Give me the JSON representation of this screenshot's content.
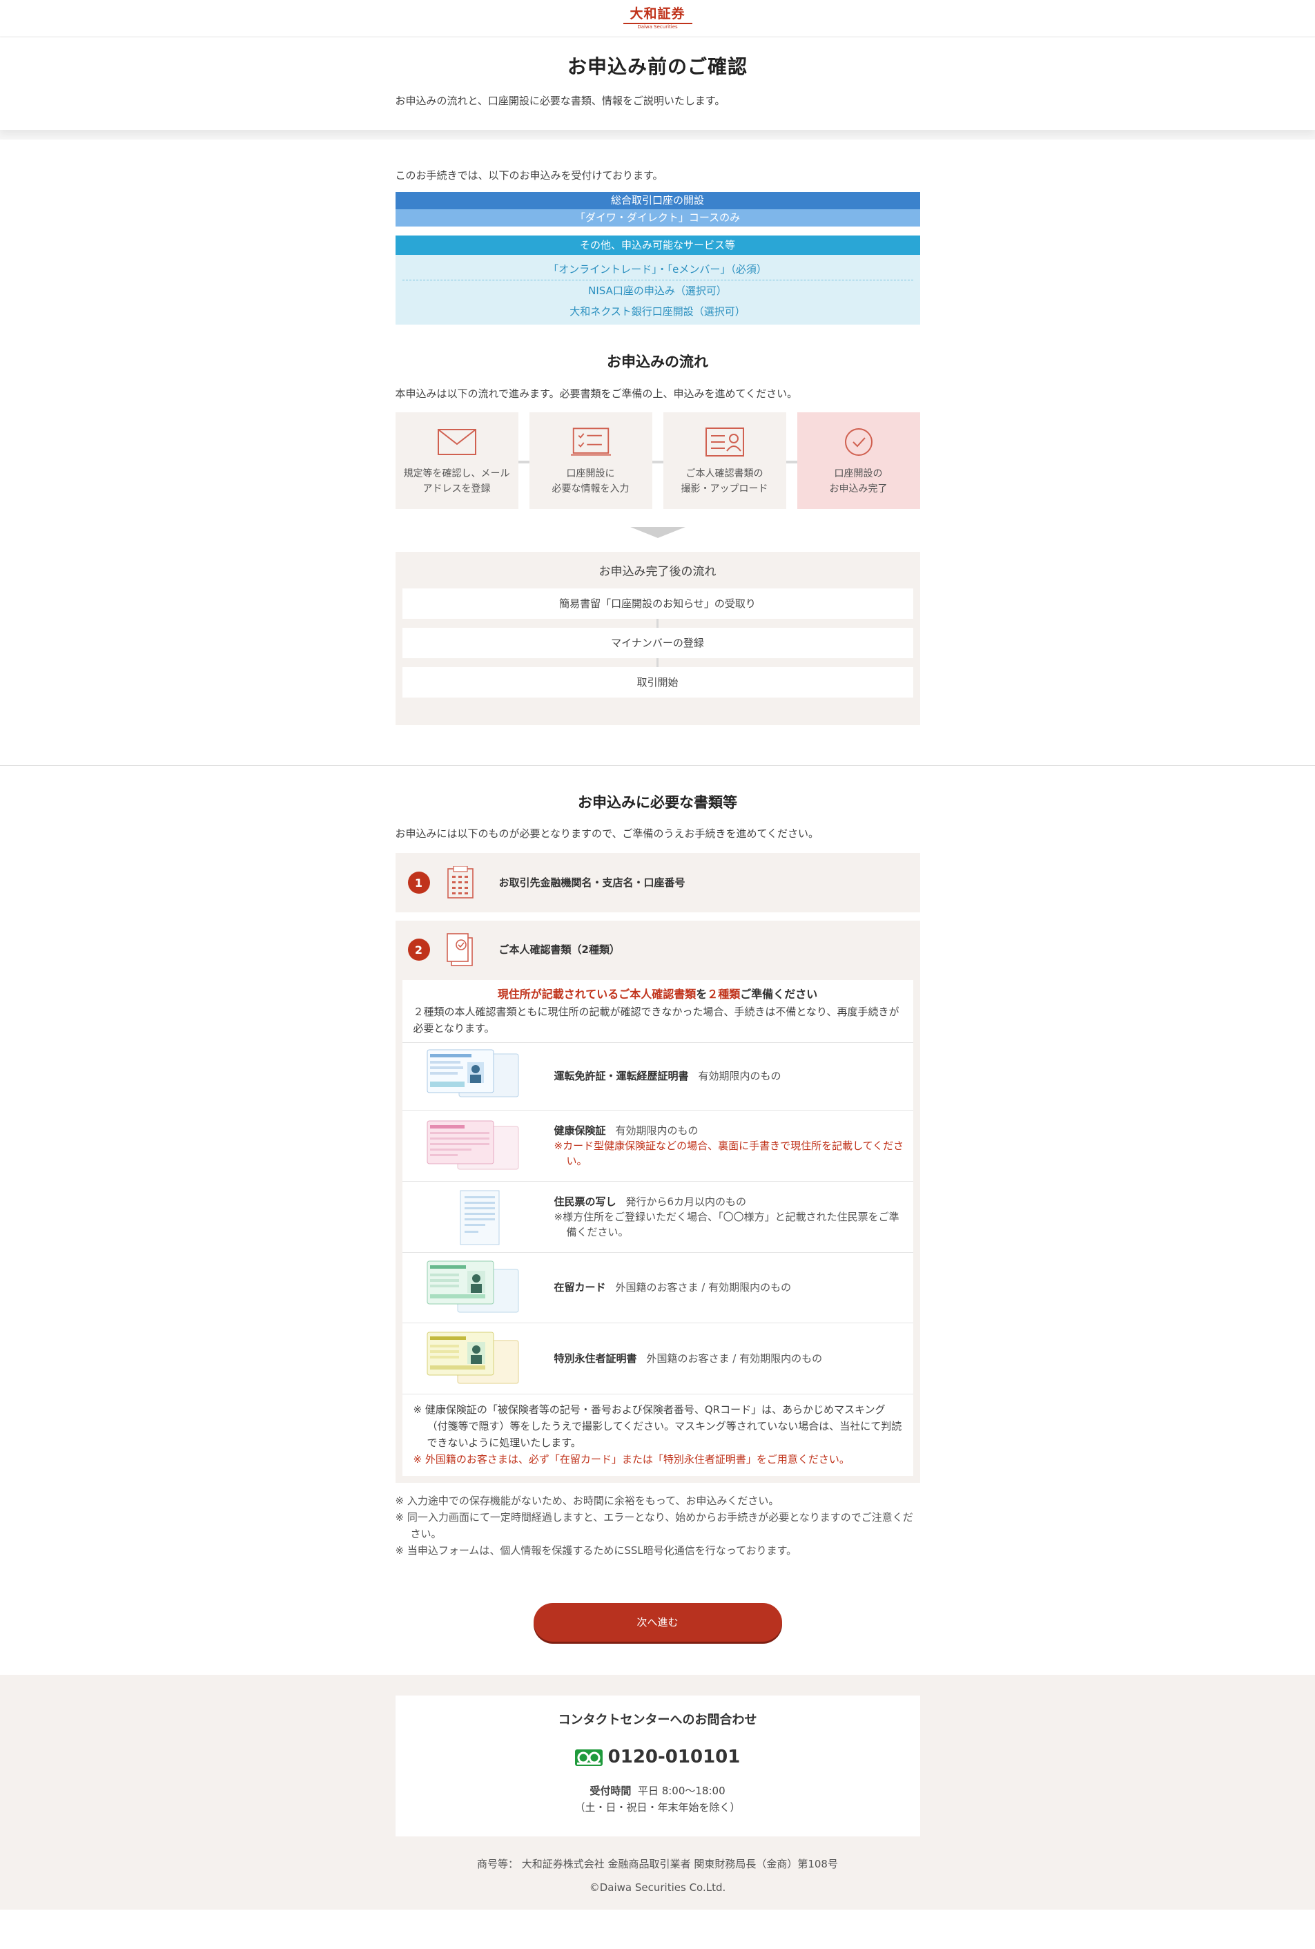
{
  "logo": {
    "jp": "大和証券",
    "en": "Daiwa Securities"
  },
  "header": {
    "title": "お申込み前のご確認",
    "subtitle": "お申込みの流れと、口座開設に必要な書類、情報をご説明いたします。"
  },
  "intro": "このお手続きでは、以下のお申込みを受付けております。",
  "service_main": {
    "title": "総合取引口座の開設",
    "sub": "「ダイワ・ダイレクト」コースのみ"
  },
  "service_other": {
    "title": "その他、申込み可能なサービス等",
    "items": [
      "「オンライントレード」・「eメンバー」（必須）",
      "NISA口座の申込み（選択可）",
      "大和ネクスト銀行口座開設（選択可）"
    ]
  },
  "flow": {
    "title": "お申込みの流れ",
    "desc": "本申込みは以下の流れで進みます。必要書類をご準備の上、申込みを進めてください。",
    "steps": [
      "規定等を確認し、メールアドレスを登録",
      "口座開設に\n必要な情報を入力",
      "ご本人確認書類の\n撮影・アップロード",
      "口座開設の\nお申込み完了"
    ],
    "after_title": "お申込み完了後の流れ",
    "after": [
      "簡易書留「口座開設のお知らせ」の受取り",
      "マイナンバーの登録",
      "取引開始"
    ]
  },
  "docs": {
    "title": "お申込みに必要な書類等",
    "desc": "お申込みには以下のものが必要となりますので、ご準備のうえお手続きを進めてください。",
    "req1": {
      "num": "1",
      "label": "お取引先金融機関名・支店名・口座番号"
    },
    "req2": {
      "num": "2",
      "label": "ご本人確認書類（2種類）"
    },
    "heading_pre": "現住所が記載されているご本人確認書類",
    "heading_mid": "を",
    "heading_num": "２種類",
    "heading_post": "ご準備ください",
    "note": "２種類の本人確認書類ともに現住所の記載が確認できなかった場合、手続きは不備となり、再度手続きが必要となります。",
    "items": [
      {
        "name": "運転免許証・運転経歴証明書",
        "cond": "有効期限内のもの"
      },
      {
        "name": "健康保険証",
        "cond": "有効期限内のもの",
        "red": "※カード型健康保険証などの場合、裏面に手書きで現住所を記載してください。"
      },
      {
        "name": "住民票の写し",
        "cond": "発行から6カ月以内のもの",
        "sub": "※様方住所をご登録いただく場合、「〇〇様方」と記載された住民票をご準備ください。"
      },
      {
        "name": "在留カード",
        "cond": "外国籍のお客さま / 有効期限内のもの"
      },
      {
        "name": "特別永住者証明書",
        "cond": "外国籍のお客さま / 有効期限内のもの"
      }
    ],
    "footnote": "※ 健康保険証の「被保険者等の記号・番号および保険者番号、QRコード」は、あらかじめマスキング（付箋等で隠す）等をしたうえで撮影してください。マスキング等されていない場合は、当社にて判読できないように処理いたします。",
    "footnote_red": "※ 外国籍のお客さまは、必ず「在留カード」または「特別永住者証明書」をご用意ください。"
  },
  "cautions": [
    "※ 入力途中での保存機能がないため、お時間に余裕をもって、お申込みください。",
    "※ 同一入力画面にて一定時間経過しますと、エラーとなり、始めからお手続きが必要となりますのでご注意ください。",
    "※ 当申込フォームは、個人情報を保護するためにSSL暗号化通信を行なっております。"
  ],
  "next_button": "次へ進む",
  "footer": {
    "contact_title": "コンタクトセンターへのお問合わせ",
    "phone": "0120-010101",
    "hours_label": "受付時間",
    "hours": "平日 8:00～18:00",
    "hours_note": "（土・日・祝日・年末年始を除く）",
    "company": "商号等： 大和証券株式会社 金融商品取引業者 関東財務局長（金商）第108号",
    "copyright": "©Daiwa Securities Co.Ltd."
  },
  "colors": {
    "brand_red": "#c0331b",
    "blue": "#3b82cc",
    "cyan": "#2aa6d6"
  }
}
